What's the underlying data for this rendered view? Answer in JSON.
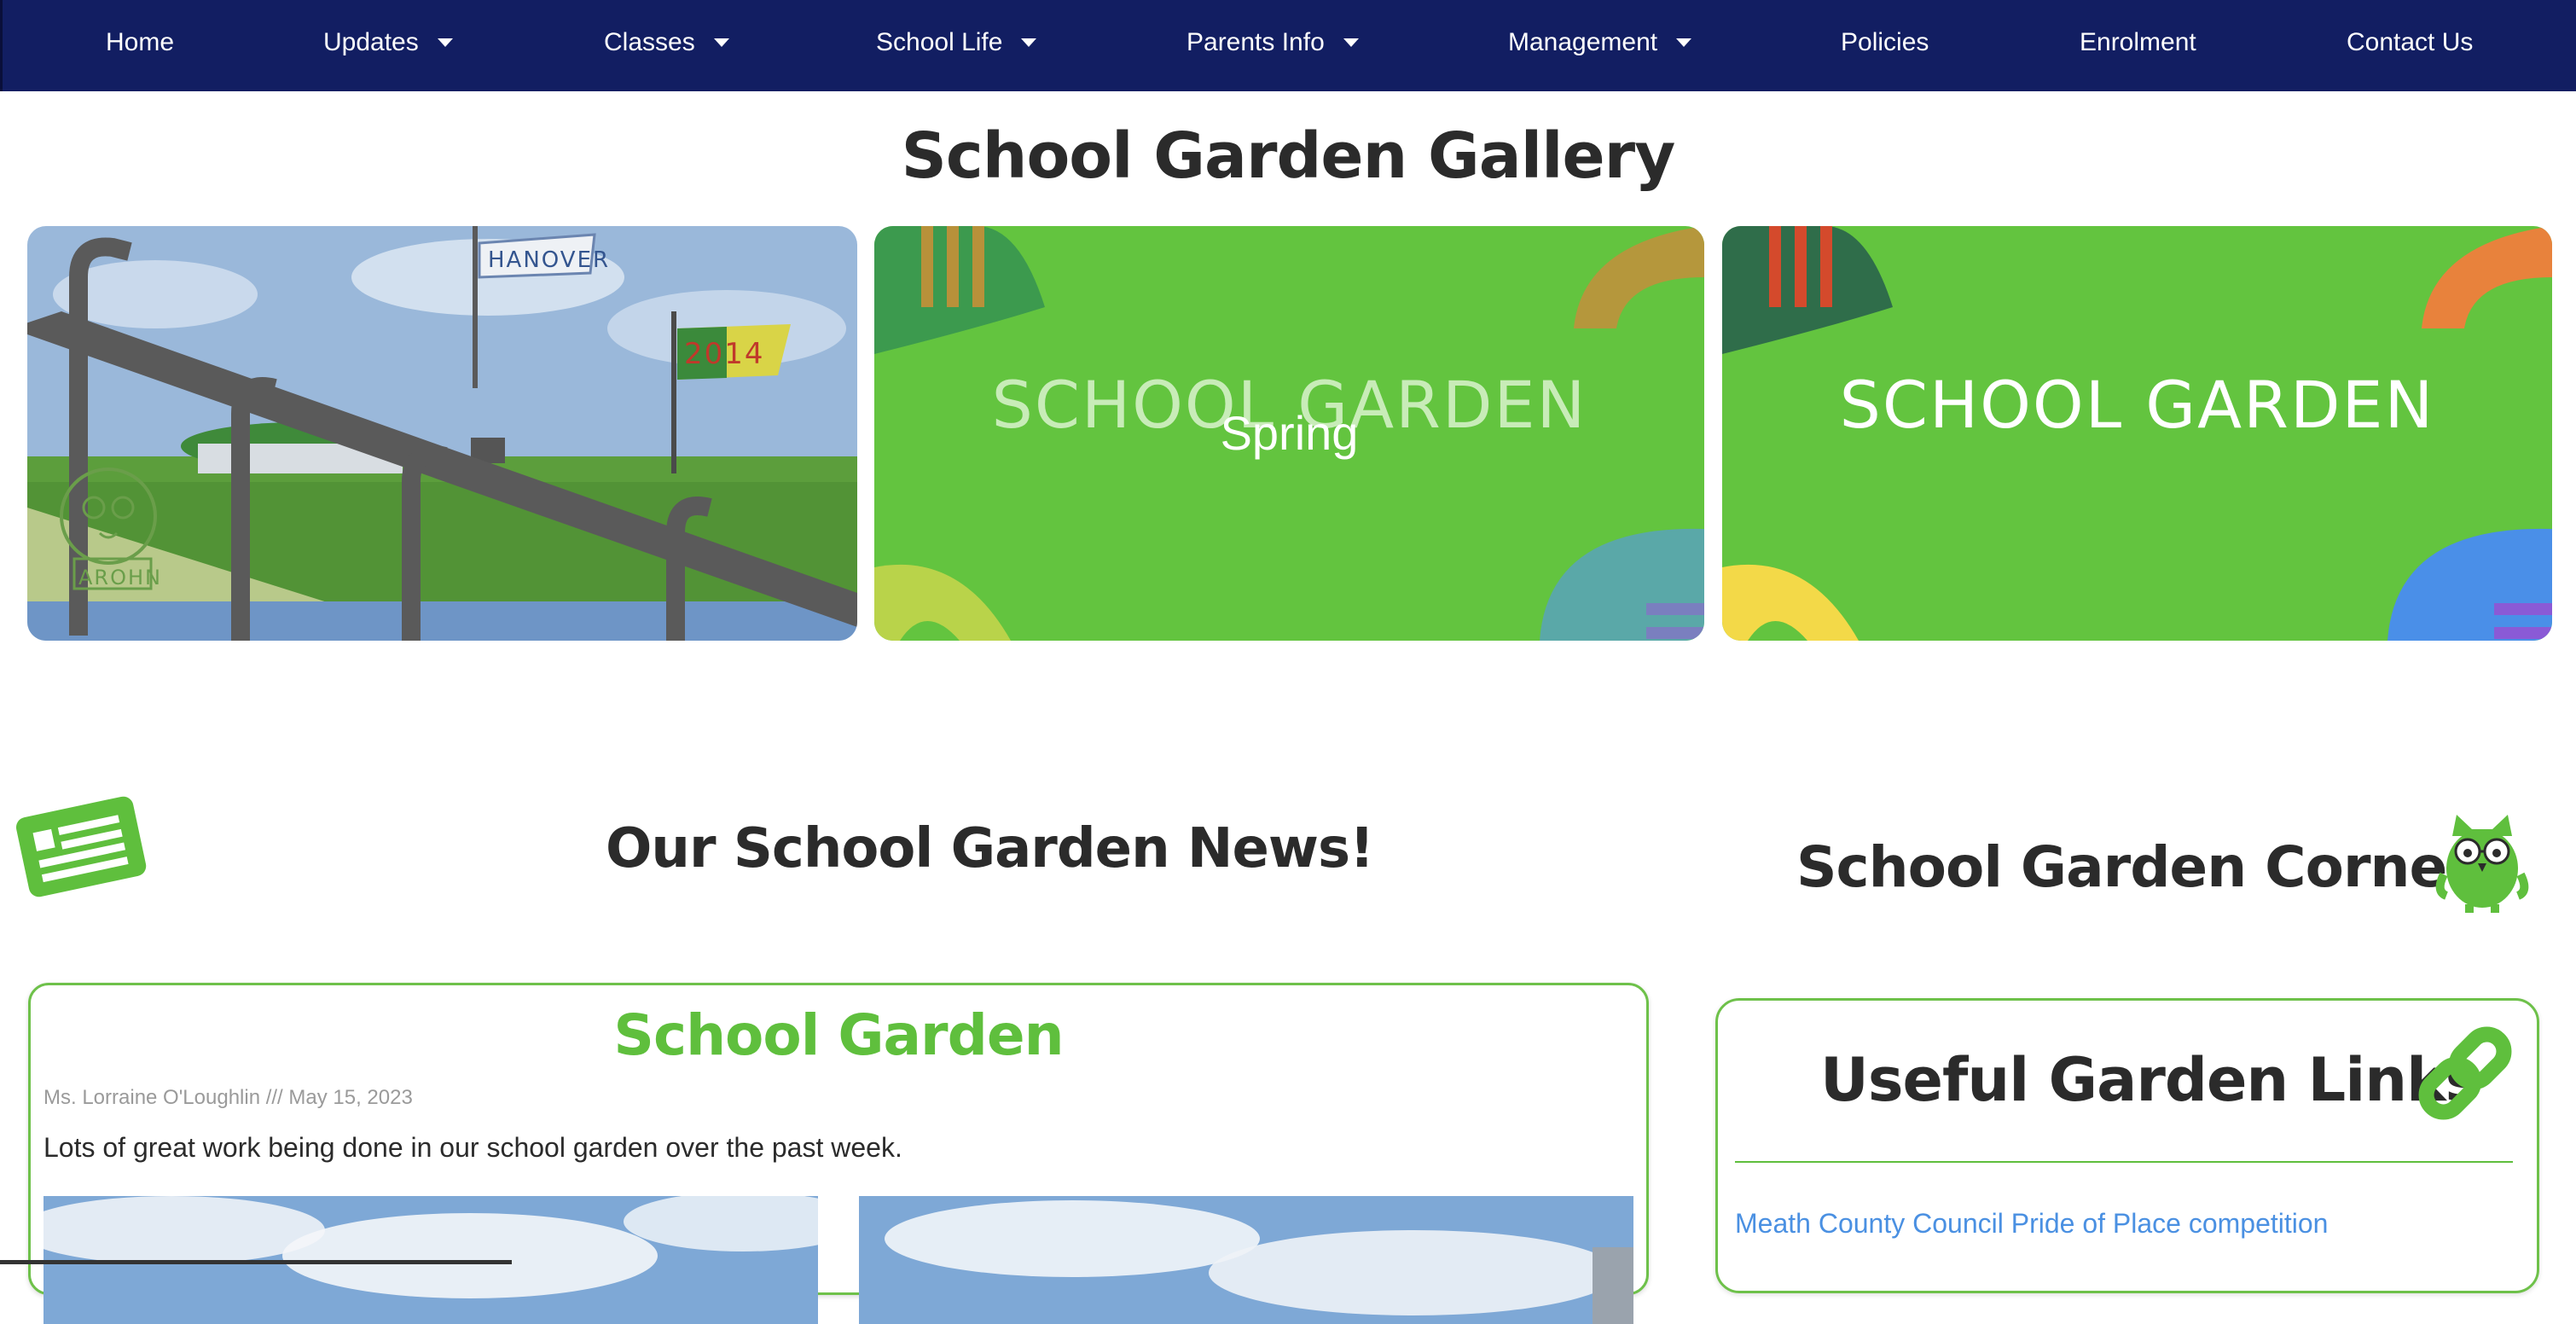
{
  "nav": {
    "items": [
      {
        "label": "Home",
        "dropdown": false
      },
      {
        "label": "Updates",
        "dropdown": true
      },
      {
        "label": "Classes",
        "dropdown": true
      },
      {
        "label": "School Life",
        "dropdown": true
      },
      {
        "label": "Parents Info",
        "dropdown": true
      },
      {
        "label": "Management",
        "dropdown": true
      },
      {
        "label": "Policies",
        "dropdown": false
      },
      {
        "label": "Enrolment",
        "dropdown": false
      },
      {
        "label": "Contact Us",
        "dropdown": false
      }
    ]
  },
  "gallery": {
    "title": "School Garden Gallery",
    "cards": [
      {
        "painting_flag_left": "HANOVER",
        "painting_flag_right": "2014",
        "painting_name": "AROHN"
      },
      {
        "label": "SCHOOL GARDEN",
        "overlay": "Spring"
      },
      {
        "label": "SCHOOL GARDEN"
      }
    ]
  },
  "news": {
    "title": "Our School Garden News!",
    "post": {
      "title": "School Garden",
      "meta": "Ms. Lorraine O'Loughlin /// May 15, 2023",
      "body": "Lots of great work being done in our school garden over the past week."
    }
  },
  "corner": {
    "title": "School Garden Corner",
    "links_title": "Useful Garden Links",
    "links": [
      "Meath County Council Pride of Place competition"
    ]
  },
  "colors": {
    "nav_bg": "#121e62",
    "accent_green": "#5fbf3d",
    "link_blue": "#4a90e2"
  },
  "icons": [
    "caret-down-icon",
    "newspaper-icon",
    "owl-icon",
    "link-chain-icon"
  ]
}
